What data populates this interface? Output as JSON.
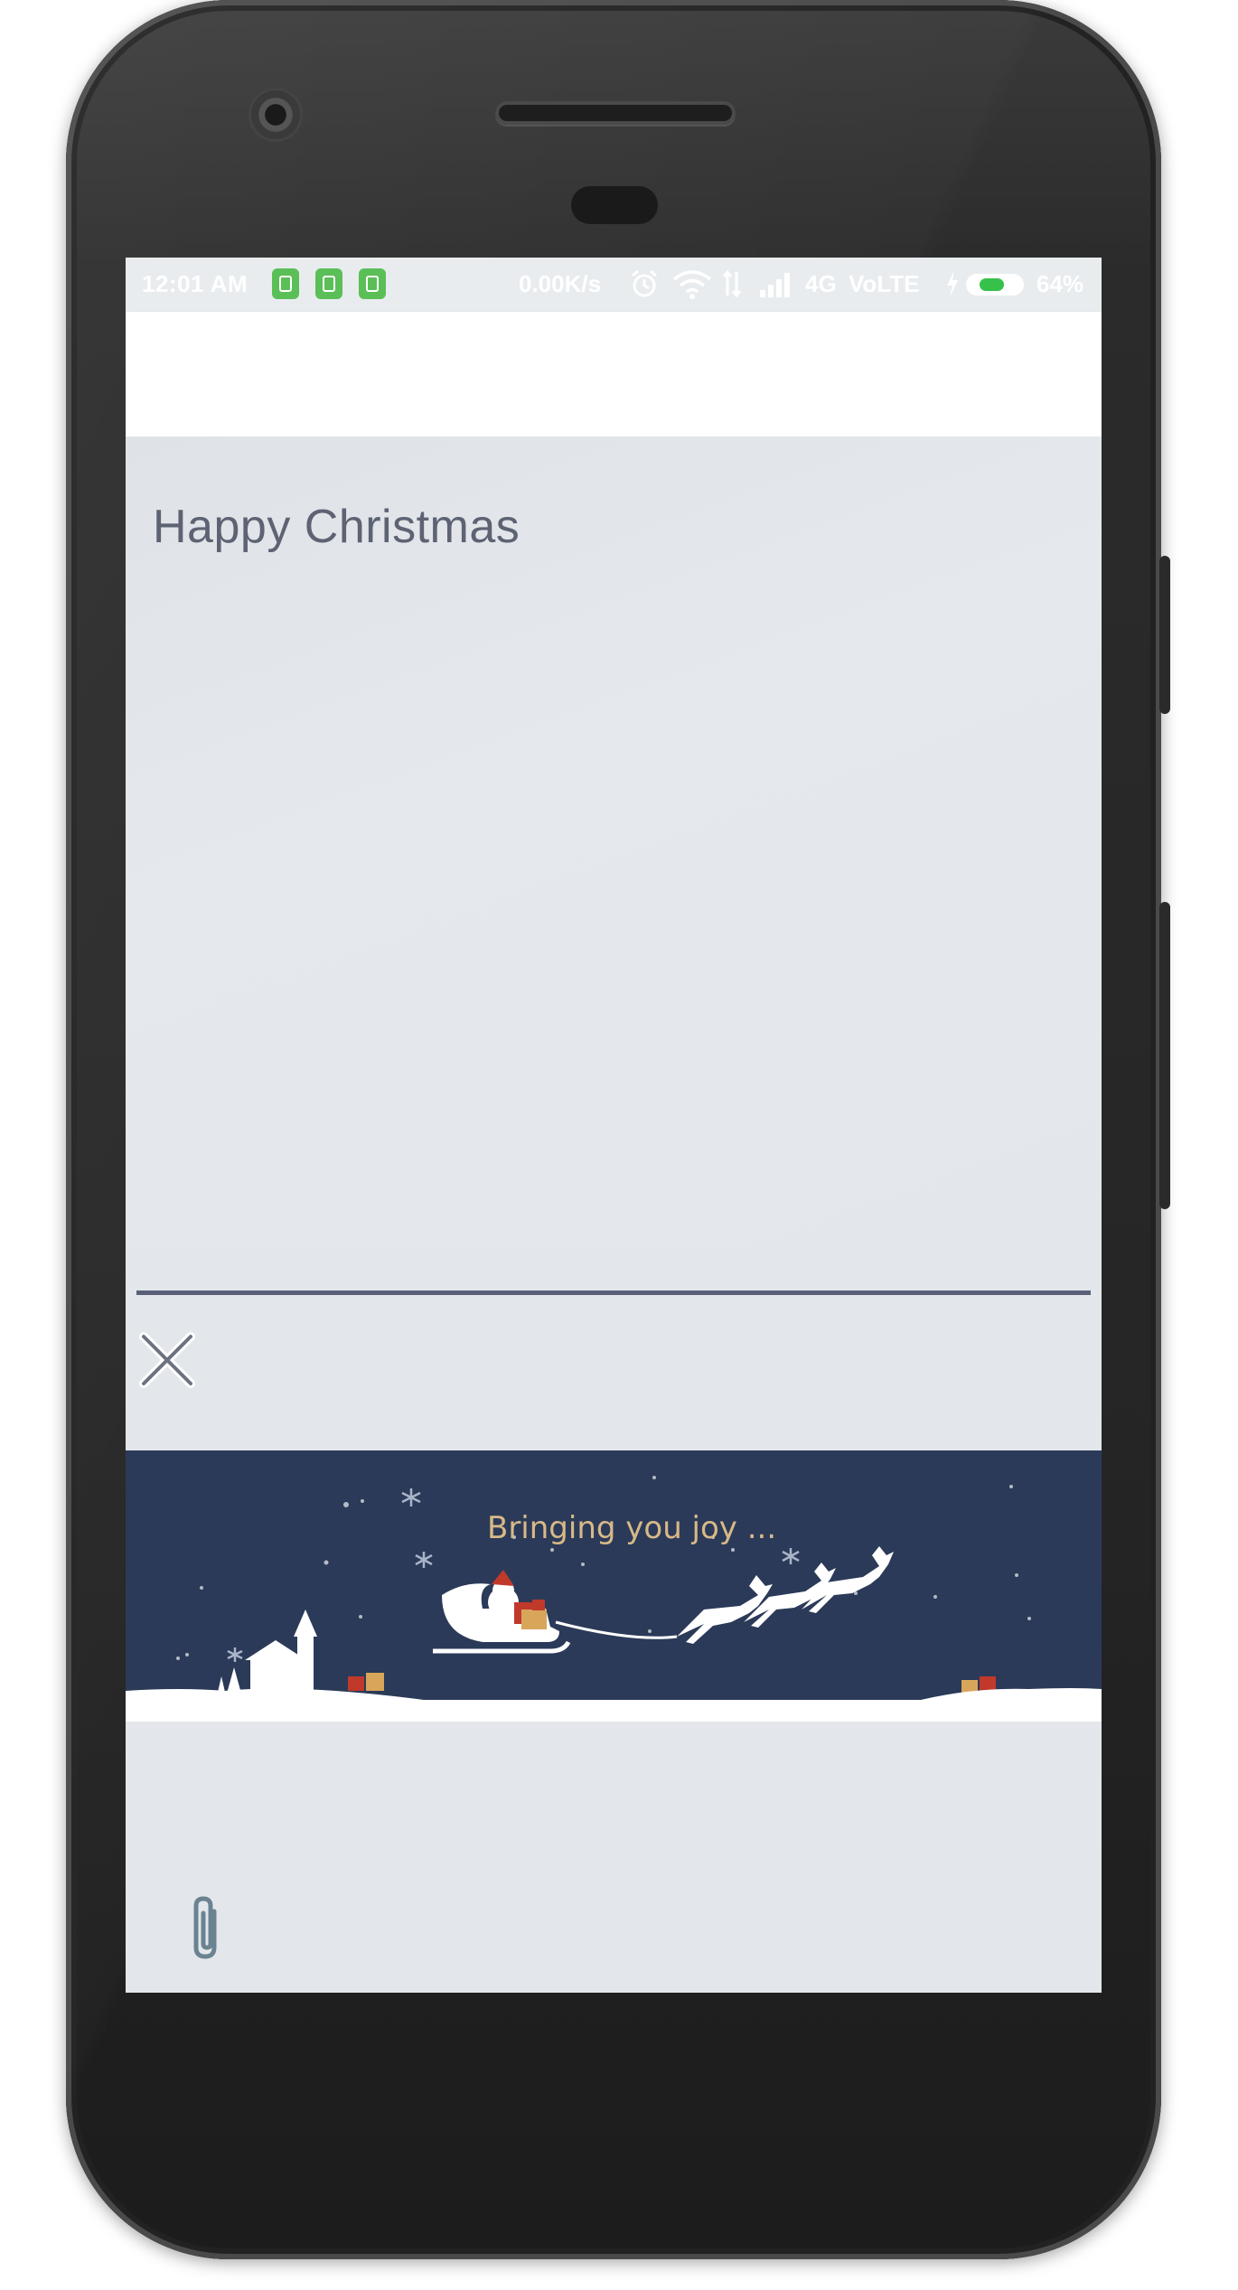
{
  "status_bar": {
    "time": "12:01 AM",
    "network_speed": "0.00K/s",
    "network_type": "4G",
    "volte": "VoLTE",
    "battery_percent": "64%",
    "battery_level": 0.64,
    "battery_color": "#36c24a",
    "notification_icons": [
      "battery-saver-icon",
      "android-icon",
      "android-icon"
    ],
    "system_icons": [
      "alarm-icon",
      "wifi-icon",
      "data-arrows-icon",
      "signal-icon",
      "charging-icon"
    ]
  },
  "message": {
    "text": "Happy Christmas",
    "text_color": "#5d6373"
  },
  "banner": {
    "caption": "Bringing you joy ...",
    "background": "#2b3a58",
    "caption_color": "#d8b988"
  },
  "controls": {
    "close_icon": "close-icon",
    "attach_icon": "paperclip-icon"
  }
}
